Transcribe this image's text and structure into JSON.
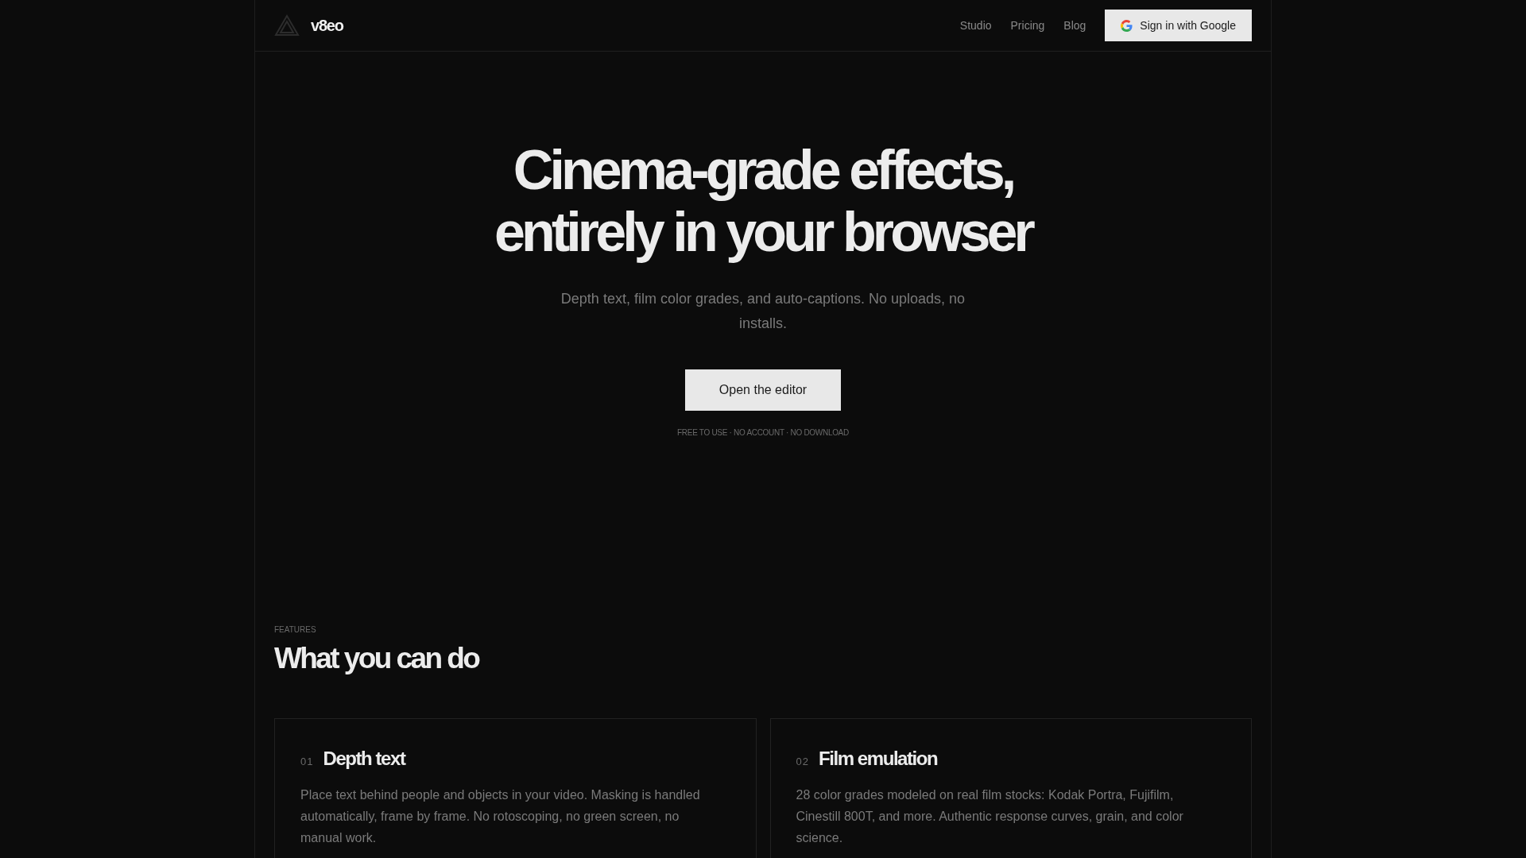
{
  "header": {
    "brand": "v8eo",
    "nav": [
      "Studio",
      "Pricing",
      "Blog"
    ],
    "sign_in": "Sign in with Google"
  },
  "hero": {
    "title_lines": [
      "Cinema-grade effects,",
      "entirely in your browser"
    ],
    "subtitle": "Depth text, film color grades, and auto-captions. No uploads, no installs.",
    "cta": "Open the editor",
    "note": "FREE TO USE · NO ACCOUNT · NO DOWNLOAD"
  },
  "features": {
    "eyebrow": "FEATURES",
    "heading": "What you can do",
    "cards": [
      {
        "number": "01",
        "title": "Depth text",
        "text": "Place text behind people and objects in your video. Masking is handled automatically, frame by frame. No rotoscoping, no green screen, no manual work."
      },
      {
        "number": "02",
        "title": "Film emulation",
        "text": "28 color grades modeled on real film stocks: Kodak Portra, Fujifilm, Cinestill 800T, and more. Authentic response curves, grain, and color science."
      }
    ]
  }
}
